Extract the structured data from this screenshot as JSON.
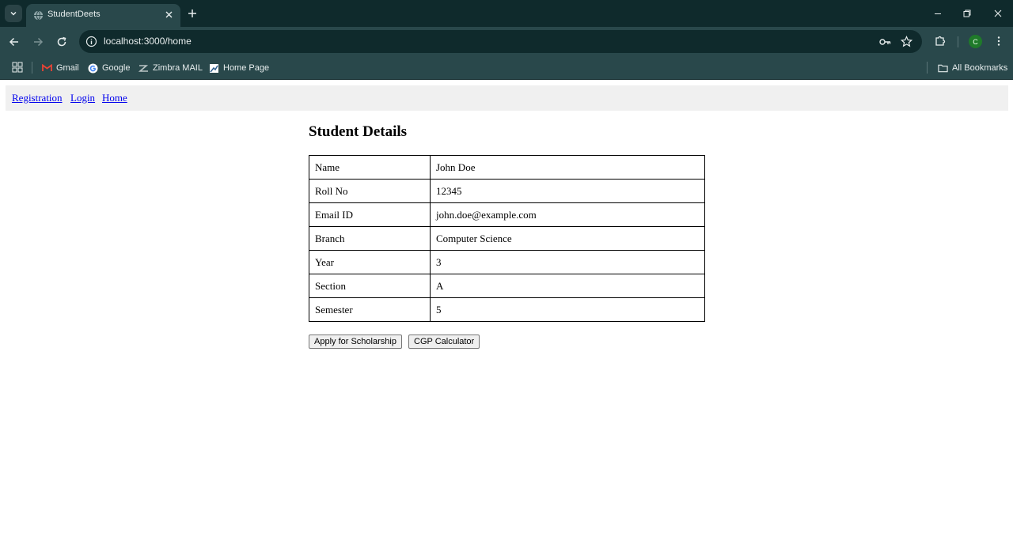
{
  "browser": {
    "tab_title": "StudentDeets",
    "url": "localhost:3000/home",
    "profile_initial": "C",
    "bookmarks": [
      {
        "label": "Gmail",
        "icon": "gmail-icon"
      },
      {
        "label": "Google",
        "icon": "google-icon"
      },
      {
        "label": "Zimbra MAIL",
        "icon": "zimbra-icon"
      },
      {
        "label": "Home Page",
        "icon": "homepage-icon"
      }
    ],
    "all_bookmarks_label": "All Bookmarks"
  },
  "nav": {
    "links": [
      "Registration",
      "Login",
      "Home"
    ]
  },
  "main": {
    "title": "Student Details",
    "rows": [
      {
        "label": "Name",
        "value": "John Doe"
      },
      {
        "label": "Roll No",
        "value": "12345"
      },
      {
        "label": "Email ID",
        "value": "john.doe@example.com"
      },
      {
        "label": "Branch",
        "value": "Computer Science"
      },
      {
        "label": "Year",
        "value": "3"
      },
      {
        "label": "Section",
        "value": "A"
      },
      {
        "label": "Semester",
        "value": "5"
      }
    ],
    "buttons": {
      "scholarship": "Apply for Scholarship",
      "cgp": "CGP Calculator"
    }
  },
  "colors": {
    "chrome_dark": "#0f2a2c",
    "chrome_light": "#29484b",
    "link": "#0000ee"
  }
}
